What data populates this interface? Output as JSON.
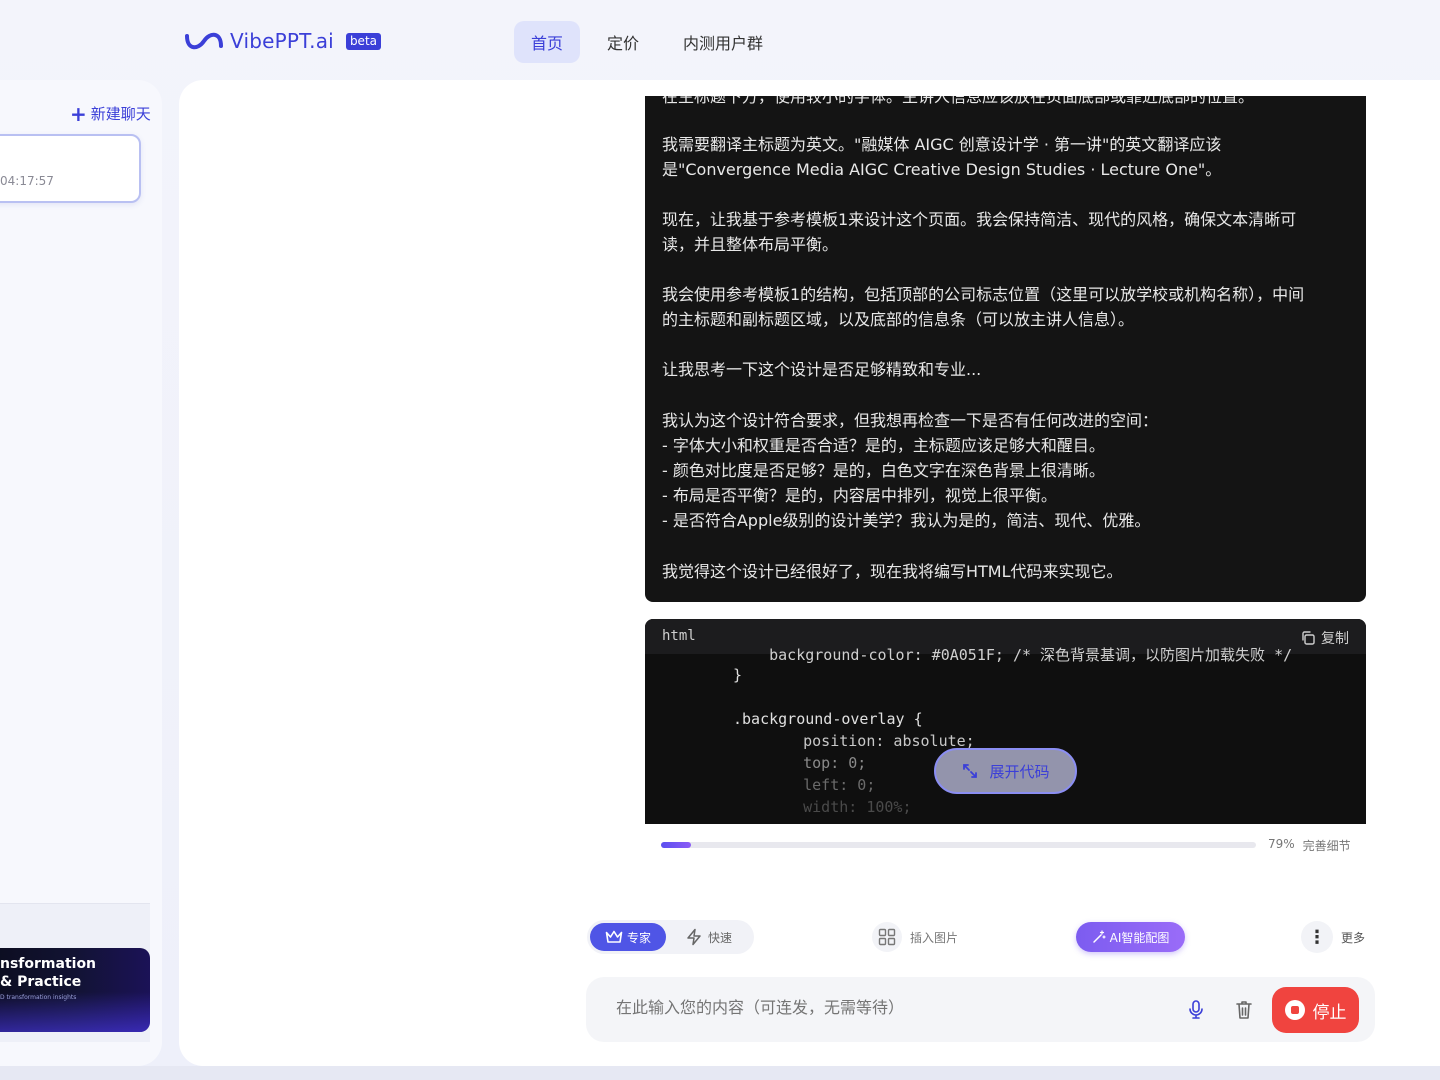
{
  "header": {
    "logo_text": "VibePPT.ai",
    "badge": "beta",
    "nav": [
      {
        "label": "首页",
        "active": true
      },
      {
        "label": "定价",
        "active": false
      },
      {
        "label": "内测用户群",
        "active": false
      }
    ]
  },
  "sidebar": {
    "new_chat_label": "新建聊天",
    "chat_item_time": "04:17:57",
    "thumbnail": {
      "line1": "nsformation",
      "line2": "& Practice",
      "line3": "D transformation insights"
    }
  },
  "thinking": {
    "paragraphs": [
      "在主标题下方，使用较小的字体。主讲人信息应该放在页面底部或靠近底部的位置。",
      "我需要翻译主标题为英文。\"融媒体 AIGC 创意设计学 · 第一讲\"的英文翻译应该",
      "是\"Convergence Media AIGC Creative Design Studies · Lecture One\"。",
      "现在，让我基于参考模板1来设计这个页面。我会保持简洁、现代的风格，确保文本清晰可",
      "读，并且整体布局平衡。",
      "我会使用参考模板1的结构，包括顶部的公司标志位置（这里可以放学校或机构名称），中间",
      "的主标题和副标题区域，以及底部的信息条（可以放主讲人信息）。",
      "让我思考一下这个设计是否足够精致和专业...",
      "我认为这个设计符合要求，但我想再检查一下是否有任何改进的空间：",
      "- 字体大小和权重是否合适？是的，主标题应该足够大和醒目。",
      "- 颜色对比度是否足够？是的，白色文字在深色背景上很清晰。",
      "- 布局是否平衡？是的，内容居中排列，视觉上很平衡。",
      "- 是否符合Apple级别的设计美学？我认为是的，简洁、现代、优雅。",
      "我觉得这个设计已经很好了，现在我将编写HTML代码来实现它。"
    ]
  },
  "code_block": {
    "language": "html",
    "copy_label": "复制",
    "lines": [
      "    background-color: #0A051F; /* 深色背景基调，以防图片加载失败 */",
      "}",
      ".background-overlay {",
      "    position: absolute;",
      "    top: 0;",
      "    left: 0;",
      "    width: 100%;"
    ],
    "expand_label": "展开代码"
  },
  "progress": {
    "fraction": 0.05,
    "percent_text": "79%",
    "status_text": "完善细节"
  },
  "toolbar": {
    "expert_label": "专家",
    "fast_label": "快速",
    "insert_image_label": "插入图片",
    "ai_image_label": "AI智能配图",
    "more_label": "更多"
  },
  "composer": {
    "placeholder": "在此输入您的内容（可连发，无需等待）",
    "stop_label": "停止"
  },
  "colors": {
    "brand": "#3b3fd8",
    "stop": "#f0443f",
    "ai_gradient_start": "#7c5cf0"
  }
}
